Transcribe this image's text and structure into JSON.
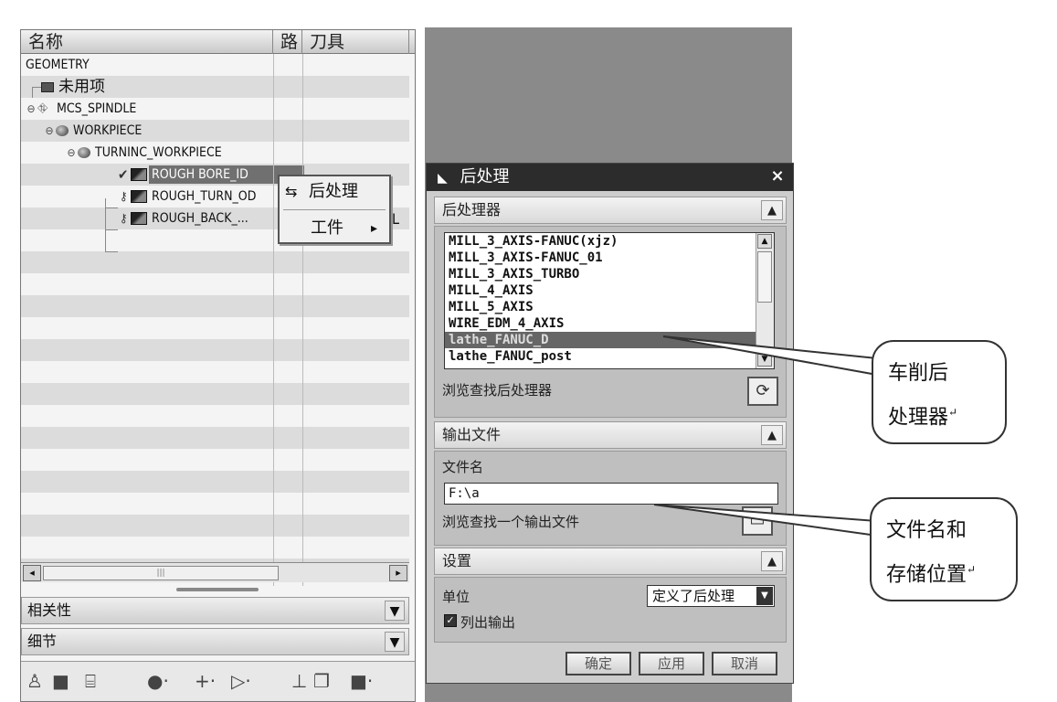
{
  "navigator": {
    "columns": [
      "名称",
      "路",
      "刀具"
    ],
    "items": [
      {
        "label": "GEOMETRY",
        "level": 0
      },
      {
        "label": "未用项",
        "level": 1
      },
      {
        "label": "MCS_SPINDLE",
        "level": 1
      },
      {
        "label": "WORKPIECE",
        "level": 2
      },
      {
        "label": "TURNINC_WORKPIECE",
        "level": 3
      },
      {
        "label": "ROUGH BORE_ID",
        "level": 4,
        "selected": true,
        "status": "check"
      },
      {
        "label": "ROUGH_TURN_OD",
        "level": 4,
        "status": "key"
      },
      {
        "label": "ROUGH_BACK_...",
        "level": 4,
        "status": "key"
      }
    ],
    "tool_fragment": "L",
    "sections": [
      "相关性",
      "细节"
    ]
  },
  "context_menu": {
    "items": [
      {
        "label": "后处理",
        "icon": "postprocess-icon"
      },
      {
        "label": "工件",
        "icon": "submenu-arrow-icon",
        "arrow": "▸"
      }
    ]
  },
  "dialog": {
    "title": "后处理",
    "close": "×",
    "postprocessor_section": "后处理器",
    "postprocessors": [
      "MILL_3_AXIS-FANUC(xjz)",
      "MILL_3_AXIS-FANUC_01",
      "MILL_3_AXIS_TURBO",
      "MILL_4_AXIS",
      "MILL_5_AXIS",
      "WIRE_EDM_4_AXIS",
      "lathe_FANUC_D",
      "lathe_FANUC_post"
    ],
    "selected_postprocessor": "lathe_FANUC_D",
    "browse_postprocessor": "浏览查找后处理器",
    "output_section": "输出文件",
    "filename_label": "文件名",
    "filename_value": "F:\\a",
    "browse_output": "浏览查找一个输出文件",
    "settings_section": "设置",
    "unit_label": "单位",
    "unit_value": "定义了后处理",
    "list_output_label": "列出输出",
    "list_output_checked": true,
    "buttons": {
      "ok": "确定",
      "apply": "应用",
      "cancel": "取消"
    }
  },
  "callouts": {
    "postprocessor": [
      "车削后",
      "处理器"
    ],
    "filename": [
      "文件名和",
      "存储位置"
    ]
  }
}
